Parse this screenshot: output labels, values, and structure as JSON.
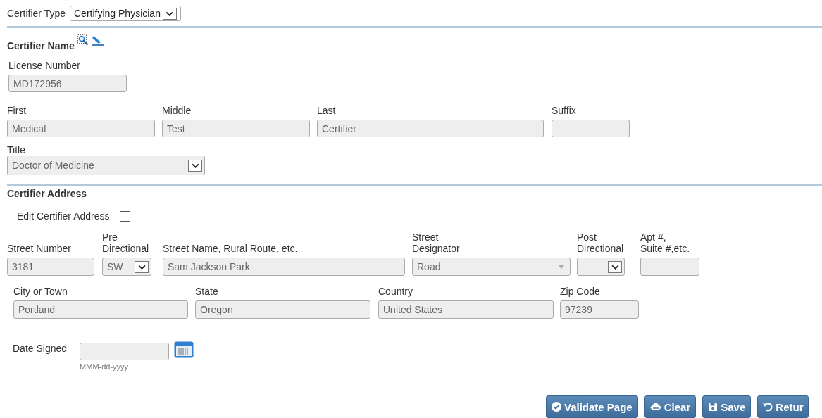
{
  "certifier_type": {
    "label": "Certifier Type",
    "value": "Certifying Physician",
    "disabled": false
  },
  "name_section": {
    "heading": "Certifier Name",
    "license": {
      "label": "License Number",
      "value": "MD172956",
      "disabled": true
    },
    "names": [
      {
        "label": "First",
        "value": "Medical",
        "disabled": true
      },
      {
        "label": "Middle",
        "value": "Test",
        "disabled": true
      },
      {
        "label": "Last",
        "value": "Certifier",
        "disabled": true
      },
      {
        "label": "Suffix",
        "disabled": true
      }
    ],
    "title": {
      "label": "Title",
      "value": "Doctor of Medicine",
      "kind": "select",
      "disabled": true
    }
  },
  "address_section": {
    "heading": "Certifier Address",
    "edit": {
      "label": "Edit Certifier Address",
      "checked": false
    },
    "street_fields": [
      {
        "label": "Street Number",
        "value": "3181",
        "kind": "text",
        "disabled": true
      },
      {
        "label": "Pre\nDirectional",
        "value": "SW",
        "kind": "select",
        "disabled": true
      },
      {
        "label": "Street Name, Rural Route, etc.",
        "value": "Sam Jackson Park",
        "kind": "text",
        "disabled": true
      },
      {
        "label": "Street\nDesignator",
        "value": "Road",
        "kind": "combo",
        "disabled": true
      },
      {
        "label": "Post\nDirectional",
        "kind": "select",
        "disabled": true
      },
      {
        "label": "Apt #,\nSuite #,etc.",
        "kind": "text",
        "disabled": true
      }
    ],
    "city_fields": [
      {
        "label": "City or Town",
        "value": "Portland",
        "disabled": true
      },
      {
        "label": "State",
        "value": "Oregon",
        "disabled": true
      },
      {
        "label": "Country",
        "value": "United States",
        "disabled": true
      },
      {
        "label": "Zip Code",
        "value": "97239",
        "disabled": true
      }
    ]
  },
  "date_signed": {
    "label": "Date Signed",
    "format": "MMM-dd-yyyy",
    "disabled": true
  },
  "buttons": [
    {
      "label": "Validate Page",
      "kind": "validate"
    },
    {
      "label": "Clear",
      "kind": "clear"
    },
    {
      "label": "Save",
      "kind": "save"
    },
    {
      "label": "Retur",
      "kind": "return"
    }
  ]
}
